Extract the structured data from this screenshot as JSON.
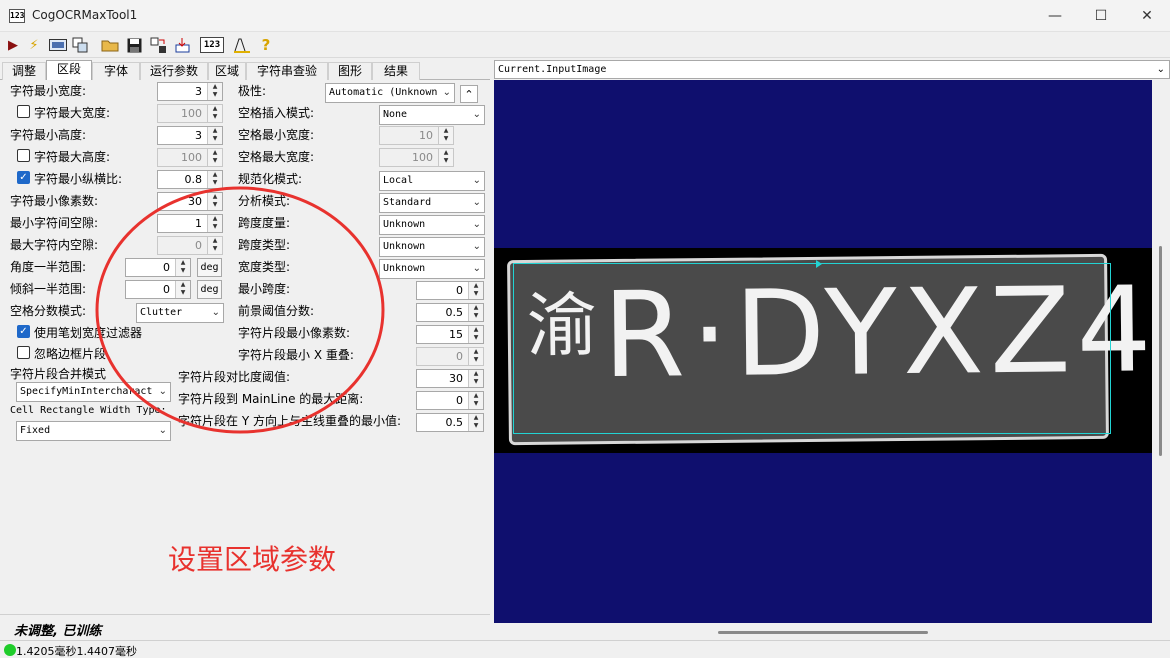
{
  "window": {
    "title": "CogOCRMaxTool1",
    "app_icon_text": "123",
    "minimize": "—",
    "maximize": "☐",
    "close": "✕"
  },
  "toolbar": {
    "run": "▶",
    "lightning": "⚡",
    "icon_123": "123"
  },
  "tabs": [
    "调整",
    "区段",
    "字体",
    "运行参数",
    "区域",
    "字符串查验",
    "图形",
    "结果"
  ],
  "segment": {
    "char_min_width": {
      "label": "字符最小宽度:",
      "value": "3"
    },
    "char_max_width": {
      "label": "字符最大宽度:",
      "value": "100"
    },
    "char_min_height": {
      "label": "字符最小高度:",
      "value": "3"
    },
    "char_max_height": {
      "label": "字符最大高度:",
      "value": "100"
    },
    "char_min_aspect": {
      "label": "字符最小纵横比:",
      "value": "0.8"
    },
    "char_min_pixels": {
      "label": "字符最小像素数:",
      "value": "30"
    },
    "min_inter_gap": {
      "label": "最小字符间空隙:",
      "value": "1"
    },
    "max_intra_gap": {
      "label": "最大字符内空隙:",
      "value": "0"
    },
    "angle_half_range": {
      "label": "角度一半范围:",
      "value": "0",
      "unit": "deg"
    },
    "skew_half_range": {
      "label": "倾斜一半范围:",
      "value": "0",
      "unit": "deg"
    },
    "gap_score_mode": {
      "label": "空格分数模式:",
      "value": "Clutter"
    },
    "stroke_width_filter": {
      "label": "使用笔划宽度过滤器"
    },
    "ignore_border_fragments": {
      "label": "忽略边框片段"
    },
    "fragment_merge_mode": {
      "label": "字符片段合并模式",
      "value": "SpecifyMinIntercharact"
    },
    "cell_rect_width_type": {
      "label": "Cell Rectangle Width Type:",
      "value": "Fixed"
    },
    "polarity": {
      "label": "极性:",
      "value": "Automatic (Unknown"
    },
    "space_insert_mode": {
      "label": "空格插入模式:",
      "value": "None"
    },
    "space_min_width": {
      "label": "空格最小宽度:",
      "value": "10"
    },
    "space_max_width": {
      "label": "空格最大宽度:",
      "value": "100"
    },
    "normalize_mode": {
      "label": "规范化模式:",
      "value": "Local"
    },
    "analysis_mode": {
      "label": "分析模式:",
      "value": "Standard"
    },
    "pitch_metric": {
      "label": "跨度度量:",
      "value": "Unknown"
    },
    "pitch_type": {
      "label": "跨度类型:",
      "value": "Unknown"
    },
    "width_type": {
      "label": "宽度类型:",
      "value": "Unknown"
    },
    "min_pitch": {
      "label": "最小跨度:",
      "value": "0"
    },
    "fg_threshold_score": {
      "label": "前景阈值分数:",
      "value": "0.5"
    },
    "fragment_min_pixels": {
      "label": "字符片段最小像素数:",
      "value": "15"
    },
    "fragment_min_x_overlap": {
      "label": "字符片段最小 X 重叠:",
      "value": "0"
    },
    "fragment_contrast_threshold": {
      "label": "字符片段对比度阈值:",
      "value": "30"
    },
    "fragment_max_dist_mainline": {
      "label": "字符片段到 MainLine 的最大距离:",
      "value": "0"
    },
    "fragment_min_y_overlap": {
      "label": "字符片段在 Y 方向上与主线重叠的最小值:",
      "value": "0.5"
    },
    "collapse_icon": "⌃"
  },
  "annotation": "设置区域参数",
  "status": {
    "training_state": "未调整, 已训练",
    "timing": "1.4205毫秒1.4407毫秒"
  },
  "image_view": {
    "selected": "Current.InputImage",
    "plate_province": "渝",
    "plate_chars": "R·DYXZ4"
  },
  "colors": {
    "annotation_red": "#e8322e",
    "display_background": "#0f0f6e",
    "region_cyan": "#22d3d3",
    "check_blue": "#1e68c9",
    "status_green": "#1fcc2a"
  }
}
